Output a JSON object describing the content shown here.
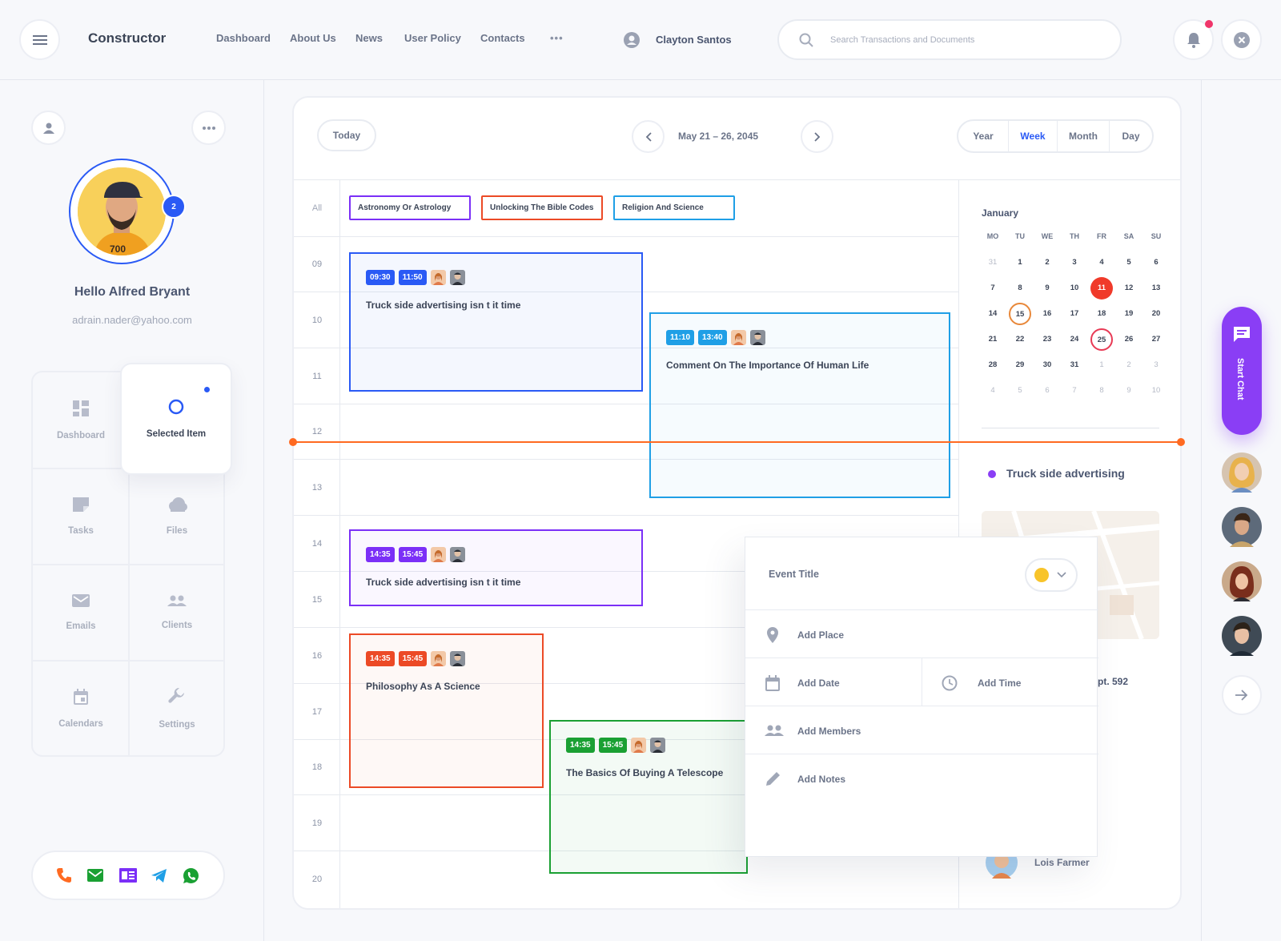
{
  "header": {
    "app_title": "Constructor",
    "nav": [
      "Dashboard",
      "About Us",
      "News",
      "User Policy",
      "Contacts"
    ],
    "more": "•••",
    "user_name": "Clayton Santos",
    "search_placeholder": "Search Transactions and Documents"
  },
  "profile": {
    "badge": "2",
    "greeting": "Hello Alfred Bryant",
    "email": "adrain.nader@yahoo.com"
  },
  "menu": [
    {
      "label": "Dashboard",
      "icon": "dashboard-icon"
    },
    {
      "label": "Selected Item",
      "icon": "circle-icon"
    },
    {
      "label": "Tasks",
      "icon": "note-icon"
    },
    {
      "label": "Files",
      "icon": "cloud-icon"
    },
    {
      "label": "Emails",
      "icon": "mail-icon"
    },
    {
      "label": "Clients",
      "icon": "people-icon"
    },
    {
      "label": "Calendars",
      "icon": "calendar-icon"
    },
    {
      "label": "Settings",
      "icon": "wrench-icon"
    }
  ],
  "calendar": {
    "today": "Today",
    "range": "May 21 – 26, 2045",
    "views": [
      "Year",
      "Week",
      "Month",
      "Day"
    ],
    "active_view": "Week",
    "all_label": "All",
    "tags": [
      "Astronomy Or Astrology",
      "Unlocking The Bible Codes",
      "Religion And Science"
    ],
    "hours": [
      "09",
      "10",
      "11",
      "12",
      "13",
      "14",
      "15",
      "16",
      "17",
      "18",
      "19",
      "20"
    ],
    "events": [
      {
        "start": "09:30",
        "end": "11:50",
        "title": "Truck side advertising isn t it time"
      },
      {
        "start": "11:10",
        "end": "13:40",
        "title": "Comment On The Importance Of Human Life"
      },
      {
        "start": "14:35",
        "end": "15:45",
        "title": "Truck side advertising isn t it time"
      },
      {
        "start": "14:35",
        "end": "15:45",
        "title": "Philosophy As A Science"
      },
      {
        "start": "14:35",
        "end": "15:45",
        "title": "The Basics Of Buying A Telescope"
      }
    ]
  },
  "mini_calendar": {
    "month": "January",
    "dow": [
      "MO",
      "TU",
      "WE",
      "TH",
      "FR",
      "SA",
      "SU"
    ],
    "weeks": [
      [
        "31",
        "1",
        "2",
        "3",
        "4",
        "5",
        "6"
      ],
      [
        "7",
        "8",
        "9",
        "10",
        "11",
        "12",
        "13"
      ],
      [
        "14",
        "15",
        "16",
        "17",
        "18",
        "19",
        "20"
      ],
      [
        "21",
        "22",
        "23",
        "24",
        "25",
        "26",
        "27"
      ],
      [
        "28",
        "29",
        "30",
        "31",
        "1",
        "2",
        "3"
      ],
      [
        "4",
        "5",
        "6",
        "7",
        "8",
        "9",
        "10"
      ]
    ],
    "today": "11",
    "ring_orange": "15",
    "ring_red": "25"
  },
  "event_detail": {
    "title": "Truck side advertising",
    "address_fragment": "pt. 592",
    "member": "Lois Farmer"
  },
  "popup": {
    "event_title": "Event Title",
    "add_place": "Add Place",
    "add_date": "Add Date",
    "add_time": "Add Time",
    "add_members": "Add Members",
    "add_notes": "Add Notes"
  },
  "chat": {
    "label": "Start Chat"
  },
  "colors": {
    "accent": "#2a5af5",
    "purple": "#7b2ff7",
    "red": "#ec4a26",
    "blue": "#1f9fe6",
    "green": "#1aa033",
    "orange": "#ff6a21",
    "chat": "#8a3ef5"
  }
}
